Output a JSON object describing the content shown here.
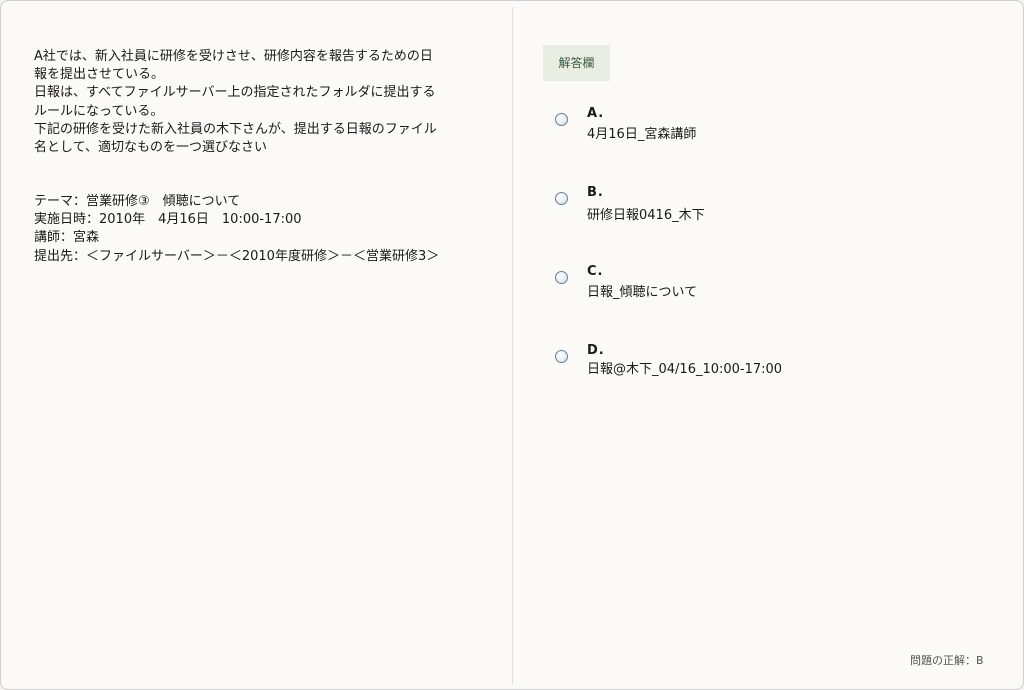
{
  "question": {
    "lines": [
      "A社では、新入社員に研修を受けさせ、研修内容を報告するための日",
      "報を提出させている。",
      "日報は、すべてファイルサーバー上の指定されたフォルダに提出する",
      "ルールになっている。",
      "下記の研修を受けた新入社員の木下さんが、提出する日報のファイル",
      "名として、適切なものを一つ選びなさい"
    ]
  },
  "info": {
    "lines": [
      "テーマ：営業研修③　傾聴について",
      "実施日時：2010年　4月16日　10:00-17:00",
      "講師：宮森",
      "提出先：＜ファイルサーバー＞－＜2010年度研修＞－＜営業研修3＞"
    ]
  },
  "answer_panel": {
    "label": "解答欄",
    "options": [
      {
        "letter": "A.",
        "text": "4月16日_宮森講師"
      },
      {
        "letter": "B.",
        "text": "研修日報0416_木下"
      },
      {
        "letter": "C.",
        "text": "日報_傾聴について"
      },
      {
        "letter": "D.",
        "text": "日報@木下_04/16_10:00-17:00"
      }
    ]
  },
  "footer": {
    "correct_answer": "問題の正解：B"
  }
}
